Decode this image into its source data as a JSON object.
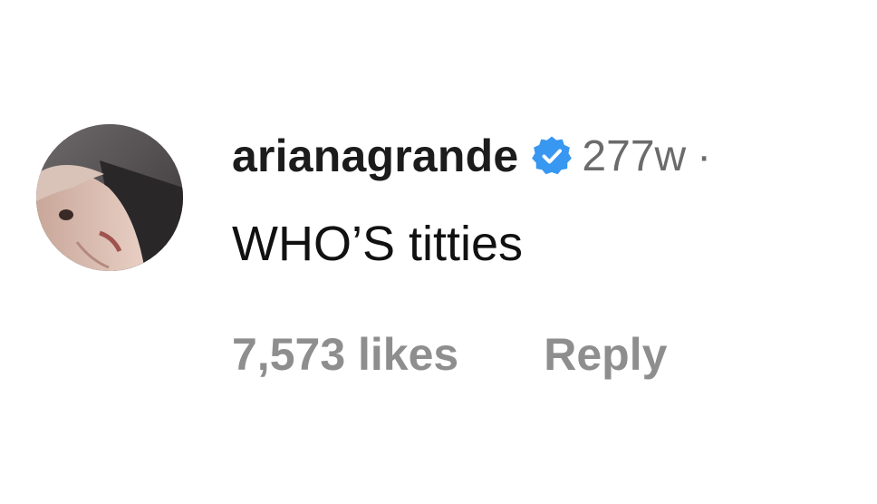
{
  "comment": {
    "username": "arianagrande",
    "verified_icon": "verified-badge-icon",
    "verified_color": "#3897f0",
    "timestamp": "277w",
    "separator": "·",
    "text": "WHO’S titties",
    "likes": "7,573 likes",
    "reply_label": "Reply"
  }
}
